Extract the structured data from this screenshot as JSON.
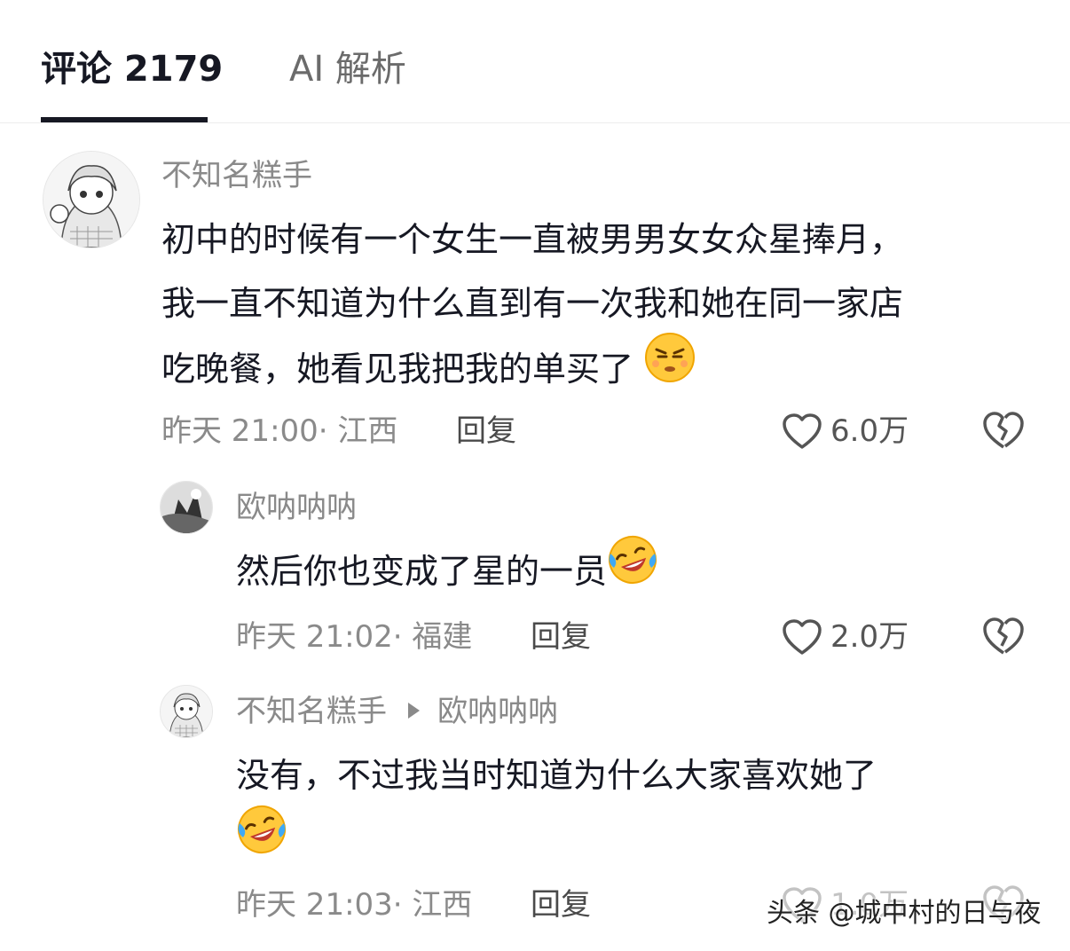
{
  "tabs": [
    {
      "label": "评论 2179",
      "active": true
    },
    {
      "label": "AI 解析",
      "active": false
    }
  ],
  "comments": [
    {
      "username": "不知名糕手",
      "lines": [
        "初中的时候有一个女生一直被男男女女众星捧月，",
        "我一直不知道为什么直到有一次我和她在同一家店",
        "吃晚餐，她看见我把我的单买了"
      ],
      "emoji": "smirk-emoji",
      "time_location": "昨天 21:00· 江西",
      "reply_label": "回复",
      "likes": "6.0万"
    },
    {
      "username": "欧呐呐呐",
      "lines": [
        "然后你也变成了星的一员"
      ],
      "emoji": "laugh-cry-emoji",
      "time_location": "昨天 21:02· 福建",
      "reply_label": "回复",
      "likes": "2.0万"
    },
    {
      "username": "不知名糕手",
      "reply_to": "欧呐呐呐",
      "lines": [
        "没有，不过我当时知道为什么大家喜欢她了"
      ],
      "emoji": "laugh-cry-emoji",
      "time_location": "昨天 21:03· 江西",
      "reply_label": "回复",
      "likes": "1.0万"
    }
  ],
  "watermark": "头条 @城中村的日与夜",
  "colors": {
    "text": "#161823",
    "secondary": "#8a8a8a",
    "divider": "#ececec",
    "emoji_yellow": "#ffc93c"
  }
}
